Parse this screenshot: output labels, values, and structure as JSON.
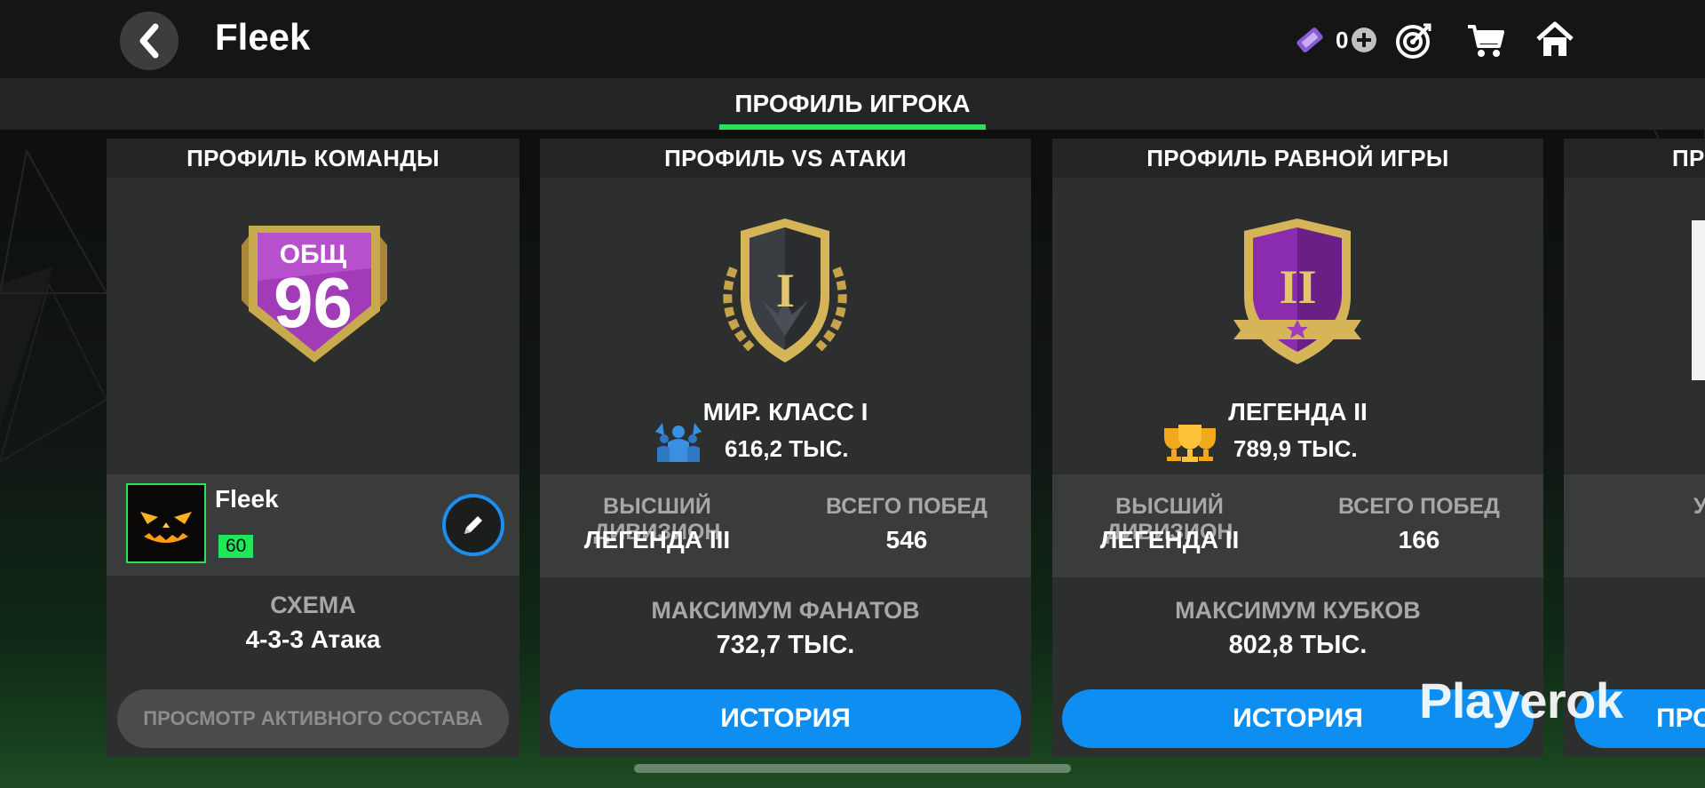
{
  "header": {
    "title": "Fleek",
    "currency_value": "0"
  },
  "tabs": {
    "active": "ПРОФИЛЬ ИГРОКА"
  },
  "team_card": {
    "title": "ПРОФИЛЬ КОМАНДЫ",
    "badge_label": "ОБЩ",
    "badge_value": "96",
    "player_name": "Fleek",
    "level": "60",
    "scheme_label": "СХЕМА",
    "scheme_value": "4-3-3 Атака",
    "button_label": "ПРОСМОТР АКТИВНОГО СОСТАВА"
  },
  "vs_attack_card": {
    "title": "ПРОФИЛЬ VS АТАКИ",
    "badge_numeral": "I",
    "rank_name": "МИР. КЛАСС I",
    "points": "616,2 ТЫС.",
    "best_division_label": "ВЫСШИЙ ДИВИЗИОН",
    "best_division_value": "ЛЕГЕНДА III",
    "total_wins_label": "ВСЕГО ПОБЕД",
    "total_wins_value": "546",
    "max_label": "МАКСИМУМ ФАНАТОВ",
    "max_value": "732,7 ТЫС.",
    "button_label": "ИСТОРИЯ"
  },
  "h2h_card": {
    "title": "ПРОФИЛЬ РАВНОЙ ИГРЫ",
    "badge_numeral": "II",
    "rank_name": "ЛЕГЕНДА II",
    "points": "789,9 ТЫС.",
    "best_division_label": "ВЫСШИЙ ДИВИЗИОН",
    "best_division_value": "ЛЕГЕНДА II",
    "total_wins_label": "ВСЕГО ПОБЕД",
    "total_wins_value": "166",
    "max_label": "МАКСИМУМ КУБКОВ",
    "max_value": "802,8 ТЫС.",
    "button_label": "ИСТОРИЯ"
  },
  "partial_card": {
    "title": "ПР",
    "stat_label": "У",
    "button_label": "ПРО"
  },
  "watermark": "Playerok",
  "colors": {
    "accent_green": "#2ce15a",
    "button_blue": "#0e8ef1",
    "gold": "#d9b85c",
    "purple": "#b048c8"
  },
  "icons": {
    "back": "chevron-left-icon",
    "currency": "ticket-icon",
    "add": "plus-circle-icon",
    "objectives": "target-icon",
    "store": "cart-icon",
    "home": "home-icon",
    "fans": "fans-icon",
    "trophies": "trophies-icon",
    "edit": "pencil-icon"
  }
}
